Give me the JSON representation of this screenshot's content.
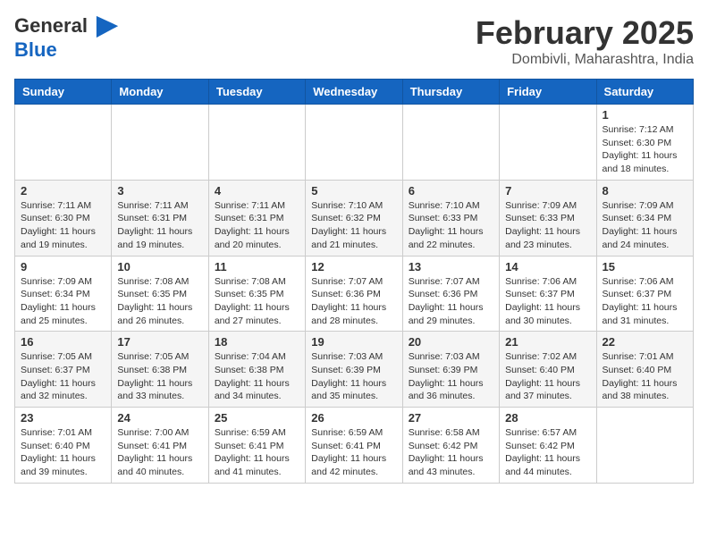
{
  "header": {
    "logo_line1": "General",
    "logo_line2": "Blue",
    "month_title": "February 2025",
    "location": "Dombivli, Maharashtra, India"
  },
  "days_of_week": [
    "Sunday",
    "Monday",
    "Tuesday",
    "Wednesday",
    "Thursday",
    "Friday",
    "Saturday"
  ],
  "weeks": [
    {
      "days": [
        {
          "num": "",
          "info": ""
        },
        {
          "num": "",
          "info": ""
        },
        {
          "num": "",
          "info": ""
        },
        {
          "num": "",
          "info": ""
        },
        {
          "num": "",
          "info": ""
        },
        {
          "num": "",
          "info": ""
        },
        {
          "num": "1",
          "info": "Sunrise: 7:12 AM\nSunset: 6:30 PM\nDaylight: 11 hours and 18 minutes."
        }
      ]
    },
    {
      "days": [
        {
          "num": "2",
          "info": "Sunrise: 7:11 AM\nSunset: 6:30 PM\nDaylight: 11 hours and 19 minutes."
        },
        {
          "num": "3",
          "info": "Sunrise: 7:11 AM\nSunset: 6:31 PM\nDaylight: 11 hours and 19 minutes."
        },
        {
          "num": "4",
          "info": "Sunrise: 7:11 AM\nSunset: 6:31 PM\nDaylight: 11 hours and 20 minutes."
        },
        {
          "num": "5",
          "info": "Sunrise: 7:10 AM\nSunset: 6:32 PM\nDaylight: 11 hours and 21 minutes."
        },
        {
          "num": "6",
          "info": "Sunrise: 7:10 AM\nSunset: 6:33 PM\nDaylight: 11 hours and 22 minutes."
        },
        {
          "num": "7",
          "info": "Sunrise: 7:09 AM\nSunset: 6:33 PM\nDaylight: 11 hours and 23 minutes."
        },
        {
          "num": "8",
          "info": "Sunrise: 7:09 AM\nSunset: 6:34 PM\nDaylight: 11 hours and 24 minutes."
        }
      ]
    },
    {
      "days": [
        {
          "num": "9",
          "info": "Sunrise: 7:09 AM\nSunset: 6:34 PM\nDaylight: 11 hours and 25 minutes."
        },
        {
          "num": "10",
          "info": "Sunrise: 7:08 AM\nSunset: 6:35 PM\nDaylight: 11 hours and 26 minutes."
        },
        {
          "num": "11",
          "info": "Sunrise: 7:08 AM\nSunset: 6:35 PM\nDaylight: 11 hours and 27 minutes."
        },
        {
          "num": "12",
          "info": "Sunrise: 7:07 AM\nSunset: 6:36 PM\nDaylight: 11 hours and 28 minutes."
        },
        {
          "num": "13",
          "info": "Sunrise: 7:07 AM\nSunset: 6:36 PM\nDaylight: 11 hours and 29 minutes."
        },
        {
          "num": "14",
          "info": "Sunrise: 7:06 AM\nSunset: 6:37 PM\nDaylight: 11 hours and 30 minutes."
        },
        {
          "num": "15",
          "info": "Sunrise: 7:06 AM\nSunset: 6:37 PM\nDaylight: 11 hours and 31 minutes."
        }
      ]
    },
    {
      "days": [
        {
          "num": "16",
          "info": "Sunrise: 7:05 AM\nSunset: 6:37 PM\nDaylight: 11 hours and 32 minutes."
        },
        {
          "num": "17",
          "info": "Sunrise: 7:05 AM\nSunset: 6:38 PM\nDaylight: 11 hours and 33 minutes."
        },
        {
          "num": "18",
          "info": "Sunrise: 7:04 AM\nSunset: 6:38 PM\nDaylight: 11 hours and 34 minutes."
        },
        {
          "num": "19",
          "info": "Sunrise: 7:03 AM\nSunset: 6:39 PM\nDaylight: 11 hours and 35 minutes."
        },
        {
          "num": "20",
          "info": "Sunrise: 7:03 AM\nSunset: 6:39 PM\nDaylight: 11 hours and 36 minutes."
        },
        {
          "num": "21",
          "info": "Sunrise: 7:02 AM\nSunset: 6:40 PM\nDaylight: 11 hours and 37 minutes."
        },
        {
          "num": "22",
          "info": "Sunrise: 7:01 AM\nSunset: 6:40 PM\nDaylight: 11 hours and 38 minutes."
        }
      ]
    },
    {
      "days": [
        {
          "num": "23",
          "info": "Sunrise: 7:01 AM\nSunset: 6:40 PM\nDaylight: 11 hours and 39 minutes."
        },
        {
          "num": "24",
          "info": "Sunrise: 7:00 AM\nSunset: 6:41 PM\nDaylight: 11 hours and 40 minutes."
        },
        {
          "num": "25",
          "info": "Sunrise: 6:59 AM\nSunset: 6:41 PM\nDaylight: 11 hours and 41 minutes."
        },
        {
          "num": "26",
          "info": "Sunrise: 6:59 AM\nSunset: 6:41 PM\nDaylight: 11 hours and 42 minutes."
        },
        {
          "num": "27",
          "info": "Sunrise: 6:58 AM\nSunset: 6:42 PM\nDaylight: 11 hours and 43 minutes."
        },
        {
          "num": "28",
          "info": "Sunrise: 6:57 AM\nSunset: 6:42 PM\nDaylight: 11 hours and 44 minutes."
        },
        {
          "num": "",
          "info": ""
        }
      ]
    }
  ]
}
